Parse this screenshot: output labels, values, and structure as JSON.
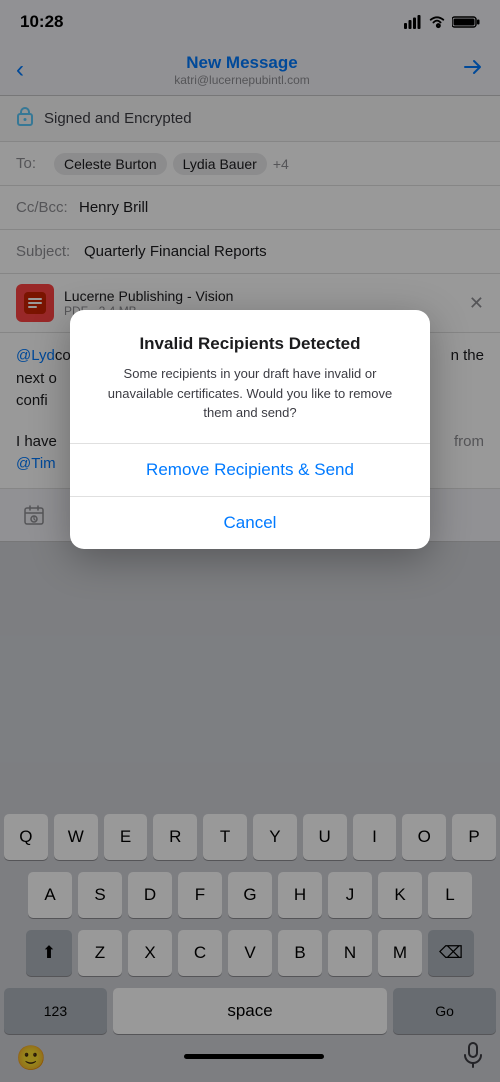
{
  "status": {
    "time": "10:28"
  },
  "header": {
    "title": "New Message",
    "subtitle": "katri@lucernepubintl.com",
    "back_label": "‹",
    "send_label": "▷"
  },
  "security": {
    "label": "Signed and Encrypted"
  },
  "to_field": {
    "label": "To:",
    "recipients": [
      "Celeste Burton",
      "Lydia Bauer"
    ],
    "more": "+4"
  },
  "cc_field": {
    "label": "Cc/Bcc:",
    "value": "Henry Brill"
  },
  "subject_field": {
    "label": "Subject:",
    "value": "Quarterly Financial Reports"
  },
  "attachment": {
    "name": "Lucerne Publishing - Vision",
    "type": "PDF",
    "size": "2.4 MB"
  },
  "body": {
    "mention": "@Lyd",
    "text_before": "",
    "text1": "conti",
    "text2": "n the",
    "text3": "next o",
    "text4": "confi",
    "spacer": "",
    "text5": "I have",
    "mention2": "@Tim",
    "text6": "from"
  },
  "dialog": {
    "title": "Invalid Recipients Detected",
    "message": "Some recipients in your draft have invalid or unavailable certificates. Would you like to remove them and send?",
    "primary_action": "Remove Recipients & Send",
    "cancel_action": "Cancel"
  },
  "keyboard": {
    "row1": [
      "Q",
      "W",
      "E",
      "R",
      "T",
      "Y",
      "U",
      "I",
      "O",
      "P"
    ],
    "row2": [
      "A",
      "S",
      "D",
      "F",
      "G",
      "H",
      "J",
      "K",
      "L"
    ],
    "row3": [
      "Z",
      "X",
      "C",
      "V",
      "B",
      "N",
      "M"
    ],
    "space_label": "space",
    "num_label": "123",
    "go_label": "Go"
  }
}
